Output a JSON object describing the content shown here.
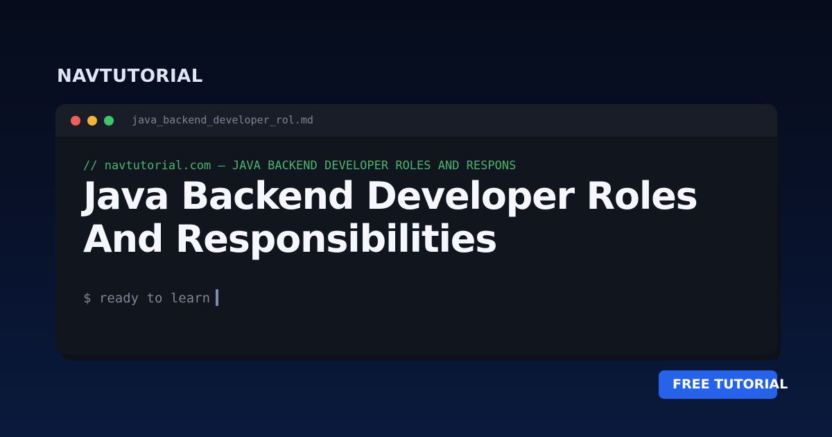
{
  "brand": {
    "name": "NAVTUTORIAL"
  },
  "window": {
    "filename": "java_backend_developer_rol.md",
    "controls": [
      {
        "icon": "close-dot-icon",
        "color": "#ef5f5a"
      },
      {
        "icon": "minimize-dot-icon",
        "color": "#f2b43a"
      },
      {
        "icon": "maximize-dot-icon",
        "color": "#3fc56b"
      }
    ]
  },
  "content": {
    "comment": "// navtutorial.com — JAVA BACKEND DEVELOPER ROLES AND RESPONS",
    "title": "Java Backend Developer Roles And Responsibilities",
    "prompt": "$ ready to learn"
  },
  "badge": {
    "label": "FREE TUTORIAL",
    "color": "#2563eb"
  },
  "colors": {
    "background_top": "#060c1b",
    "background_bottom": "#0a1a3d",
    "window_body": "#11151d",
    "titlebar": "#181d27",
    "comment_green": "#49b56f"
  }
}
